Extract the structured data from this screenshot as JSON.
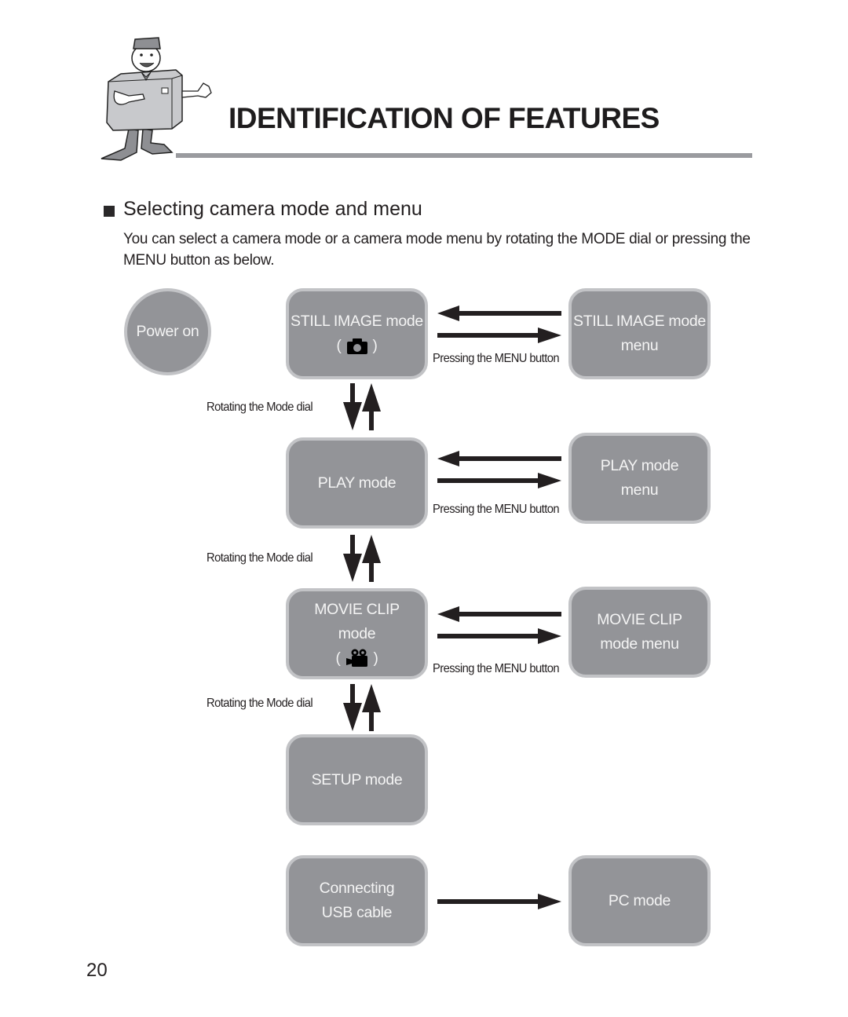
{
  "header": {
    "title": "IDENTIFICATION OF FEATURES",
    "mascot_icon": "camera-mascot-icon"
  },
  "section": {
    "heading": "Selecting camera mode and menu",
    "description": "You can select a camera mode or a camera mode menu by rotating the MODE dial or pressing the MENU button as below."
  },
  "diagram": {
    "start": {
      "label": "Power on"
    },
    "modes": [
      {
        "lines": [
          "STILL IMAGE mode"
        ],
        "icon": "camera-icon",
        "menu_lines": [
          "STILL IMAGE mode",
          "menu"
        ],
        "menu_action": "Pressing the MENU button"
      },
      {
        "lines": [
          "PLAY mode"
        ],
        "icon": null,
        "menu_lines": [
          "PLAY mode",
          "menu"
        ],
        "menu_action": "Pressing the MENU button"
      },
      {
        "lines": [
          "MOVIE CLIP",
          "mode"
        ],
        "icon": "movie-camera-icon",
        "menu_lines": [
          "MOVIE CLIP",
          "mode menu"
        ],
        "menu_action": "Pressing the MENU button"
      },
      {
        "lines": [
          "SETUP mode"
        ],
        "icon": null
      }
    ],
    "dial_action": "Rotating the Mode dial",
    "usb": {
      "lines": [
        "Connecting",
        "USB cable"
      ],
      "target": "PC mode"
    },
    "icon_paren_open": "(",
    "icon_paren_close": ")"
  },
  "colors": {
    "box_fill": "#939498",
    "box_border": "#c2c3c6",
    "box_text": "#f4f4f4",
    "arrow": "#231f20",
    "rule": "#9a9b9f"
  },
  "footer": {
    "page_number": "20"
  }
}
